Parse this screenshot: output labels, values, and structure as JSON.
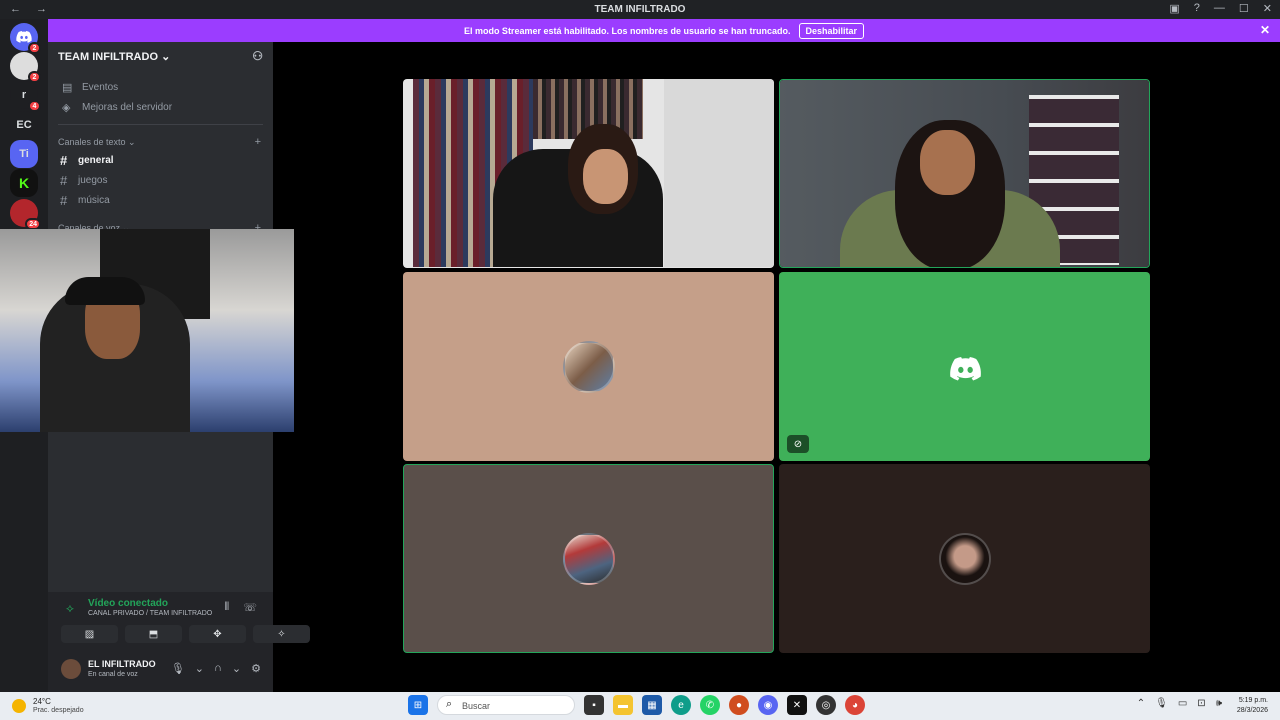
{
  "window": {
    "title": "TEAM INFILTRADO",
    "nav": "← →",
    "controls": [
      "▣",
      "?",
      "—",
      "☐",
      "✕"
    ]
  },
  "banner": {
    "text": "El modo Streamer está habilitado. Los nombres de usuario se han truncado.",
    "button": "Deshabilitar",
    "close": "✕"
  },
  "servers": [
    {
      "label": "",
      "badge": "2"
    },
    {
      "label": "",
      "badge": "2"
    },
    {
      "label": "r",
      "badge": "4"
    },
    {
      "label": "EC",
      "badge": ""
    },
    {
      "label": "Ti",
      "badge": ""
    },
    {
      "label": "",
      "badge": ""
    },
    {
      "label": "",
      "badge": "24"
    }
  ],
  "sidebar": {
    "server_name": "TEAM INFILTRADO",
    "chevron": "⌄",
    "items": [
      {
        "icon": "calendar-icon",
        "glyph": "▤",
        "label": "Eventos"
      },
      {
        "icon": "boost-icon",
        "glyph": "◈",
        "label": "Mejoras del servidor"
      }
    ],
    "category": "Canales de texto",
    "channels": [
      {
        "name": "general",
        "active": true
      },
      {
        "name": "juegos",
        "active": false
      },
      {
        "name": "música",
        "active": false
      }
    ],
    "category2": "Canales de voz"
  },
  "voice": {
    "status": "Vídeo conectado",
    "channel": "CANAL PRIVADO / TEAM INFILTRADO",
    "buttons": [
      "▨",
      "⬒",
      "✥",
      "✧"
    ]
  },
  "user": {
    "name": "EL INFILTRADO",
    "status": "En canal de voz"
  },
  "call_tiles": [
    {
      "type": "video",
      "selected": false
    },
    {
      "type": "video",
      "selected": true
    },
    {
      "type": "avatar",
      "bg": "#c59f89",
      "selected": false
    },
    {
      "type": "discord",
      "bg": "#3fb059",
      "selected": false,
      "muted": true
    },
    {
      "type": "avatar",
      "bg": "#5a4f4a",
      "selected": true
    },
    {
      "type": "avatar",
      "bg": "#2a1f1c",
      "selected": false
    }
  ],
  "taskbar": {
    "temp": "24°C",
    "weather": "Prac. despejado",
    "search_placeholder": "Buscar",
    "time": "5:19 p.m.",
    "date": "28/3/2026"
  }
}
